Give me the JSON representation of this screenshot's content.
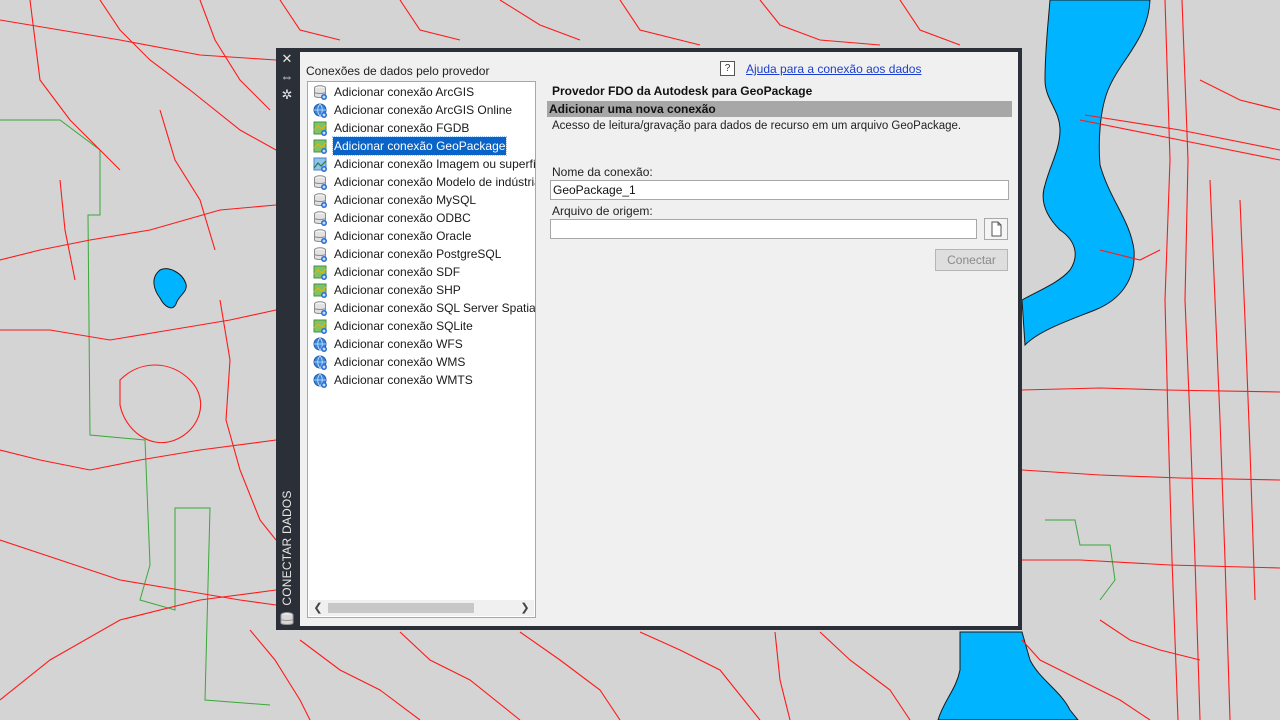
{
  "palette": {
    "vertical_title": "CONECTAR DADOS",
    "buttons": {
      "close_symbol": "✕",
      "autohide_symbol": "⇔",
      "properties_symbol": "✲"
    }
  },
  "providers": {
    "label": "Conexões de dados pelo provedor",
    "items": [
      {
        "label": "Adicionar conexão ArcGIS",
        "icon": "database-icon"
      },
      {
        "label": "Adicionar conexão ArcGIS Online",
        "icon": "globe-icon"
      },
      {
        "label": "Adicionar conexão FGDB",
        "icon": "raster-icon"
      },
      {
        "label": "Adicionar conexão GeoPackage",
        "icon": "raster-icon",
        "selected": true
      },
      {
        "label": "Adicionar conexão Imagem ou superfície",
        "icon": "image-icon"
      },
      {
        "label": "Adicionar conexão Modelo de indústria",
        "icon": "database-icon"
      },
      {
        "label": "Adicionar conexão MySQL",
        "icon": "database-icon"
      },
      {
        "label": "Adicionar conexão ODBC",
        "icon": "database-icon"
      },
      {
        "label": "Adicionar conexão Oracle",
        "icon": "database-icon"
      },
      {
        "label": "Adicionar conexão PostgreSQL",
        "icon": "database-icon"
      },
      {
        "label": "Adicionar conexão SDF",
        "icon": "raster-icon"
      },
      {
        "label": "Adicionar conexão SHP",
        "icon": "raster-icon"
      },
      {
        "label": "Adicionar conexão SQL Server Spatial",
        "icon": "database-icon"
      },
      {
        "label": "Adicionar conexão SQLite",
        "icon": "raster-icon"
      },
      {
        "label": "Adicionar conexão WFS",
        "icon": "globe-icon"
      },
      {
        "label": "Adicionar conexão WMS",
        "icon": "globe-icon"
      },
      {
        "label": "Adicionar conexão WMTS",
        "icon": "globe-icon"
      }
    ]
  },
  "help": {
    "icon_text": "?",
    "link": "Ajuda para a conexão aos dados"
  },
  "detail": {
    "provider_title": "Provedor FDO da Autodesk para GeoPackage",
    "section_title": "Adicionar uma nova conexão",
    "description": "Acesso de leitura/gravação para dados de recurso em um arquivo GeoPackage.",
    "name_label": "Nome da conexão:",
    "name_value": "GeoPackage_1",
    "source_label": "Arquivo de origem:",
    "source_value": "",
    "connect_button": "Conectar"
  },
  "colors": {
    "map_background": "#d4d4d4",
    "roads": "#ff1a1a",
    "boundary": "#3aa83a",
    "water": "#00b4ff",
    "selection": "#0a64c8",
    "palette_frame": "#2b3038"
  }
}
